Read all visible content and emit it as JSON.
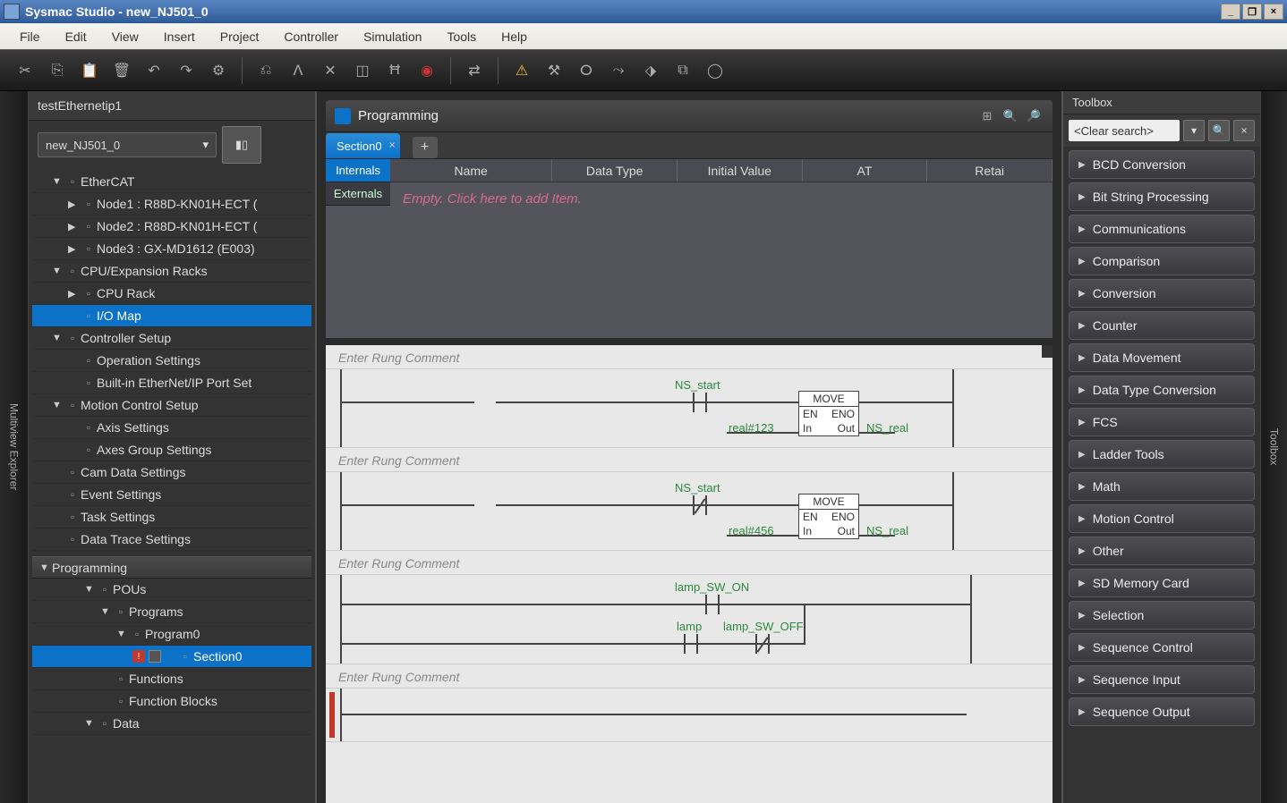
{
  "titlebar": {
    "text": "Sysmac Studio - new_NJ501_0"
  },
  "menus": [
    "File",
    "Edit",
    "View",
    "Insert",
    "Project",
    "Controller",
    "Simulation",
    "Tools",
    "Help"
  ],
  "leftPanel": {
    "projectName": "testEthernetip1",
    "combobox": "new_NJ501_0",
    "tree": [
      {
        "lvl": 1,
        "arrow": "▼",
        "label": "EtherCAT"
      },
      {
        "lvl": 2,
        "arrow": "▶",
        "label": "Node1 : R88D-KN01H-ECT ("
      },
      {
        "lvl": 2,
        "arrow": "▶",
        "label": "Node2 : R88D-KN01H-ECT ("
      },
      {
        "lvl": 2,
        "arrow": "▶",
        "label": "Node3 : GX-MD1612 (E003)"
      },
      {
        "lvl": 1,
        "arrow": "▼",
        "label": "CPU/Expansion Racks"
      },
      {
        "lvl": 2,
        "arrow": "▶",
        "label": "CPU Rack"
      },
      {
        "lvl": 2,
        "arrow": "",
        "label": "I/O Map",
        "selected": true
      },
      {
        "lvl": 1,
        "arrow": "▼",
        "label": "Controller Setup"
      },
      {
        "lvl": 2,
        "arrow": "",
        "label": "Operation Settings"
      },
      {
        "lvl": 2,
        "arrow": "",
        "label": "Built-in EtherNet/IP Port Set"
      },
      {
        "lvl": 1,
        "arrow": "▼",
        "label": "Motion Control Setup"
      },
      {
        "lvl": 2,
        "arrow": "",
        "label": "Axis Settings"
      },
      {
        "lvl": 2,
        "arrow": "",
        "label": "Axes Group Settings"
      },
      {
        "lvl": 1,
        "arrow": "",
        "label": "Cam Data Settings"
      },
      {
        "lvl": 1,
        "arrow": "",
        "label": "Event Settings"
      },
      {
        "lvl": 1,
        "arrow": "",
        "label": "Task Settings"
      },
      {
        "lvl": 1,
        "arrow": "",
        "label": "Data Trace Settings"
      }
    ],
    "programming": {
      "header": "Programming",
      "items": [
        {
          "lvl": 3,
          "arrow": "▼",
          "label": "POUs"
        },
        {
          "lvl": 4,
          "arrow": "▼",
          "label": "Programs"
        },
        {
          "lvl": 5,
          "arrow": "▼",
          "label": "Program0"
        },
        {
          "lvl": 6,
          "arrow": "",
          "label": "Section0",
          "selected": true,
          "err": true
        },
        {
          "lvl": 4,
          "arrow": "",
          "label": "Functions"
        },
        {
          "lvl": 4,
          "arrow": "",
          "label": "Function Blocks"
        },
        {
          "lvl": 3,
          "arrow": "▼",
          "label": "Data"
        }
      ]
    }
  },
  "leftGutter": "Multiview Explorer",
  "center": {
    "title": "Programming",
    "tab": "Section0",
    "varTabs": {
      "internals": "Internals",
      "externals": "Externals"
    },
    "varCols": [
      "Name",
      "Data Type",
      "Initial Value",
      "AT",
      "Retai"
    ],
    "emptyText": "Empty. Click here to add Item.",
    "rungComment": "Enter Rung Comment",
    "rung1": {
      "ns_start": "NS_start",
      "inConst": "real#123",
      "out": "NS_real",
      "fbTitle": "MOVE",
      "en": "EN",
      "eno": "ENO",
      "in": "In",
      "outp": "Out"
    },
    "rung2": {
      "ns_start": "NS_start",
      "inConst": "real#456",
      "out": "NS_real",
      "fbTitle": "MOVE",
      "en": "EN",
      "eno": "ENO",
      "in": "In",
      "outp": "Out"
    },
    "rung3": {
      "sig1": "lamp_SW_ON",
      "sig2": "lamp",
      "sig3": "lamp_SW_OFF"
    }
  },
  "toolbox": {
    "header": "Toolbox",
    "searchPlaceholder": "<Clear search>",
    "categories": [
      "BCD Conversion",
      "Bit String Processing",
      "Communications",
      "Comparison",
      "Conversion",
      "Counter",
      "Data Movement",
      "Data Type Conversion",
      "FCS",
      "Ladder Tools",
      "Math",
      "Motion Control",
      "Other",
      "SD Memory Card",
      "Selection",
      "Sequence Control",
      "Sequence Input",
      "Sequence Output"
    ]
  },
  "rightGutter": "Toolbox"
}
